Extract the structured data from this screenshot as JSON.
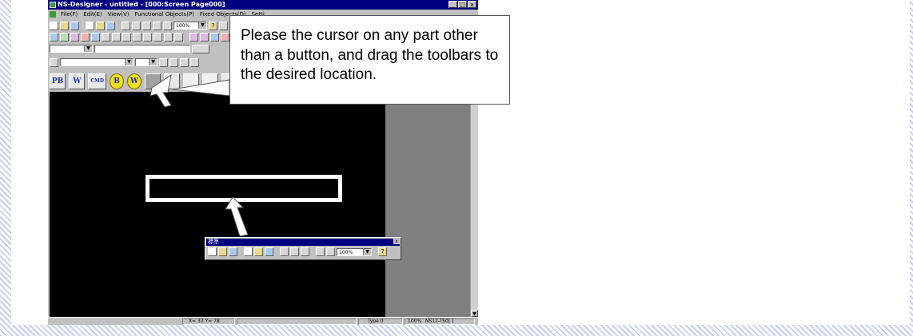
{
  "app": {
    "title": "NS-Designer - untitled - [000:Screen Page000]",
    "window_buttons": [
      "_",
      "□",
      "x"
    ]
  },
  "menu": {
    "items": [
      "File(F)",
      "Edit(E)",
      "View(V)",
      "Functional Objects(P)",
      "Fixed Objects(D)",
      "Setti..."
    ]
  },
  "toolbar": {
    "zoom": "100%"
  },
  "object_bar": {
    "labels": [
      "PB",
      "W",
      "CMD",
      "B",
      "W"
    ]
  },
  "float_toolbar": {
    "title": "標準",
    "close": "x",
    "zoom": "100%"
  },
  "callout": {
    "text": "Please the cursor on any part other than a button, and drag the toolbars to the desired location."
  },
  "status": {
    "coords": "X= 33 Y= 78",
    "type": "Type 0",
    "zoom": "100%",
    "model": "NS12-TS0[ ]"
  }
}
